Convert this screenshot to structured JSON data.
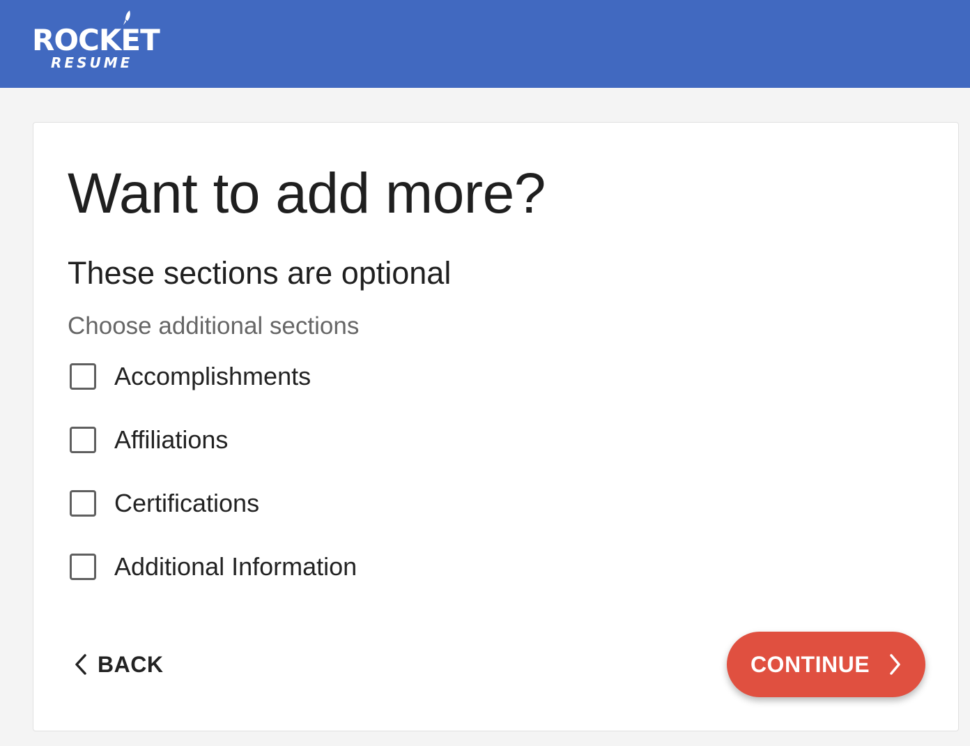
{
  "brand": {
    "name": "ROCKET",
    "tagline": "RESUME",
    "header_color": "#4169c0"
  },
  "page": {
    "title": "Want to add more?",
    "subtitle": "These sections are optional",
    "helper": "Choose additional sections"
  },
  "options": [
    {
      "label": "Accomplishments",
      "checked": false
    },
    {
      "label": "Affiliations",
      "checked": false
    },
    {
      "label": "Certifications",
      "checked": false
    },
    {
      "label": "Additional Information",
      "checked": false
    }
  ],
  "nav": {
    "back_label": "BACK",
    "back_icon": "chevron-left-icon",
    "continue_label": "CONTINUE",
    "continue_icon": "chevron-right-icon",
    "continue_color": "#e05040"
  }
}
